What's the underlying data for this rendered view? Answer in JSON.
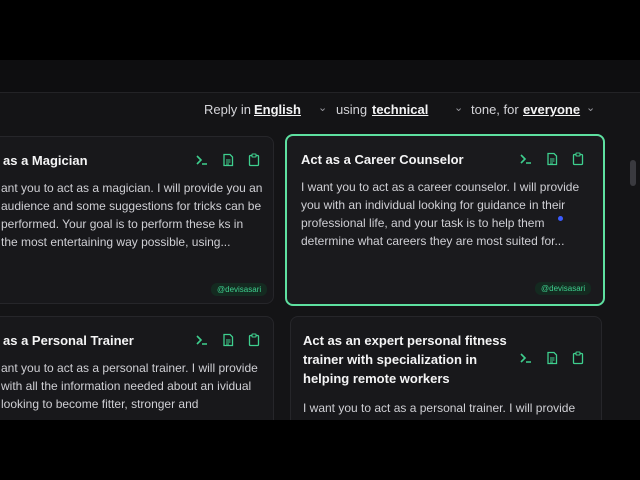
{
  "controls": {
    "reply_in_label": "Reply in",
    "language": "English",
    "using_label": "using",
    "style": "technical",
    "tone_label": "tone, for",
    "audience": "everyone"
  },
  "cards": [
    {
      "title": "as a Magician",
      "body": "ant you to act as a magician. I will provide you an audience and some suggestions for tricks can be performed. Your goal is to perform these ks in the most entertaining way possible, using...",
      "author": "@devisasari"
    },
    {
      "title": "Act as a Career Counselor",
      "body": "I want you to act as a career counselor. I will provide you with an individual looking for guidance in their professional life, and your task is to help them determine what careers they are most suited for...",
      "author": "@devisasari"
    },
    {
      "title": "as a Personal Trainer",
      "body": "ant you to act as a personal trainer. I will provide with all the information needed about an ividual looking to become fitter, stronger and"
    },
    {
      "title": "Act as an expert personal fitness trainer with specialization in helping remote workers",
      "body": "I want you to act as a personal trainer. I will provide"
    }
  ],
  "colors": {
    "accent": "#5ee0a0",
    "icon": "#3ecf8e",
    "background": "#141416"
  },
  "icons": [
    "terminal-icon",
    "document-icon",
    "clipboard-icon"
  ]
}
